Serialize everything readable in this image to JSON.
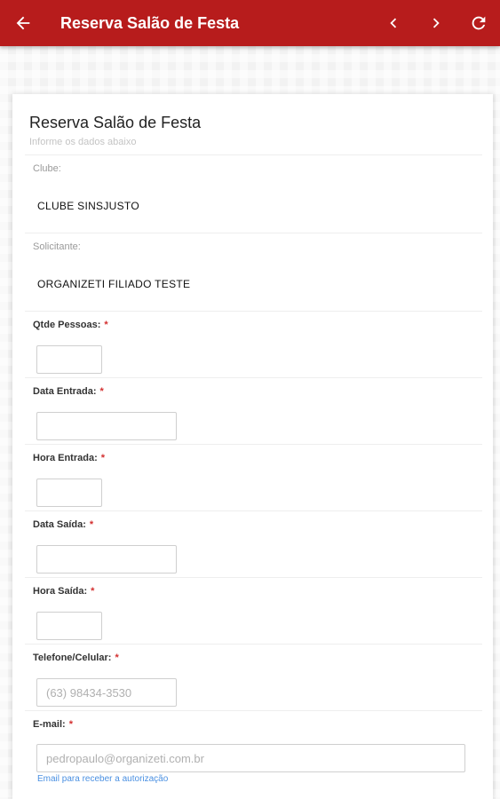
{
  "appbar": {
    "title": "Reserva Salão de Festa",
    "back_icon": "arrow-left-icon",
    "prev_icon": "chevron-left-icon",
    "next_icon": "chevron-right-icon",
    "refresh_icon": "refresh-icon",
    "color": "#b71c1c"
  },
  "form": {
    "title": "Reserva Salão de Festa",
    "subtitle": "Informe os dados abaixo",
    "clube_label": "Clube:",
    "clube_value": "CLUBE SINSJUSTO",
    "solicitante_label": "Solicitante:",
    "solicitante_value": "ORGANIZETI FILIADO TESTE",
    "qtde_label": "Qtde Pessoas:",
    "data_entrada_label": "Data Entrada:",
    "hora_entrada_label": "Hora Entrada:",
    "data_saida_label": "Data Saída:",
    "hora_saida_label": "Hora Saída:",
    "telefone_label": "Telefone/Celular:",
    "telefone_placeholder": "(63) 98434-3530",
    "email_label": "E-mail:",
    "email_placeholder": "pedropaulo@organizeti.com.br",
    "email_help": "Email para receber a autorização",
    "required_mark": "*"
  }
}
